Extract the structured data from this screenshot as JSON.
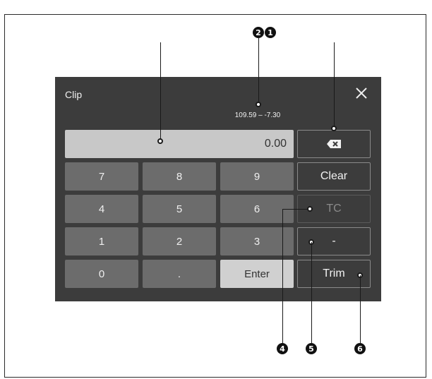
{
  "dialog": {
    "title": "Clip",
    "range": "109.59 – -7.30",
    "display_value": "0.00"
  },
  "keypad": {
    "rows": [
      [
        "7",
        "8",
        "9"
      ],
      [
        "4",
        "5",
        "6"
      ],
      [
        "1",
        "2",
        "3"
      ],
      [
        "0",
        ".",
        "Enter"
      ]
    ]
  },
  "side_buttons": {
    "clear": "Clear",
    "tc": "TC",
    "minus": "-",
    "trim": "Trim"
  },
  "callouts": {
    "badge_1": "1",
    "badge_2": "2",
    "badge_4": "4",
    "badge_5": "5",
    "badge_6": "6"
  },
  "colors": {
    "dialog_bg": "#3c3c3c",
    "key_bg": "#6c6c6c",
    "display_bg": "#c8c8c8",
    "enter_bg": "#d0d0d0"
  }
}
